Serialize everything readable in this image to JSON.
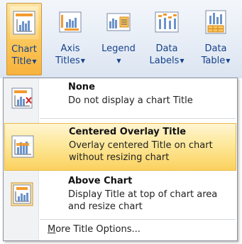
{
  "ribbon": {
    "buttons": [
      {
        "line1": "Chart",
        "line2": "Title",
        "caret": "▼",
        "icon": "chart-title-icon"
      },
      {
        "line1": "Axis",
        "line2": "Titles",
        "caret": "▼",
        "icon": "axis-titles-icon"
      },
      {
        "line1": "Legend",
        "line2": "",
        "caret": "▼",
        "icon": "legend-icon"
      },
      {
        "line1": "Data",
        "line2": "Labels",
        "caret": "▼",
        "icon": "data-labels-icon"
      },
      {
        "line1": "Data",
        "line2": "Table",
        "caret": "▼",
        "icon": "data-table-icon"
      }
    ],
    "active_index": 0
  },
  "menu": {
    "items": [
      {
        "title": "None",
        "description": "Do not display a chart Title",
        "icon": "no-title-icon"
      },
      {
        "title": "Centered Overlay Title",
        "description": "Overlay centered Title on chart without resizing chart",
        "icon": "overlay-title-icon"
      },
      {
        "title": "Above Chart",
        "description": "Display Title at top of chart area and resize chart",
        "icon": "above-chart-icon"
      }
    ],
    "more_options": {
      "underlined": "M",
      "rest": "ore Title Options..."
    }
  },
  "colors": {
    "ribbon_text": "#15428b",
    "highlight": "#fbd15f",
    "active_button": "#f8b23c"
  }
}
